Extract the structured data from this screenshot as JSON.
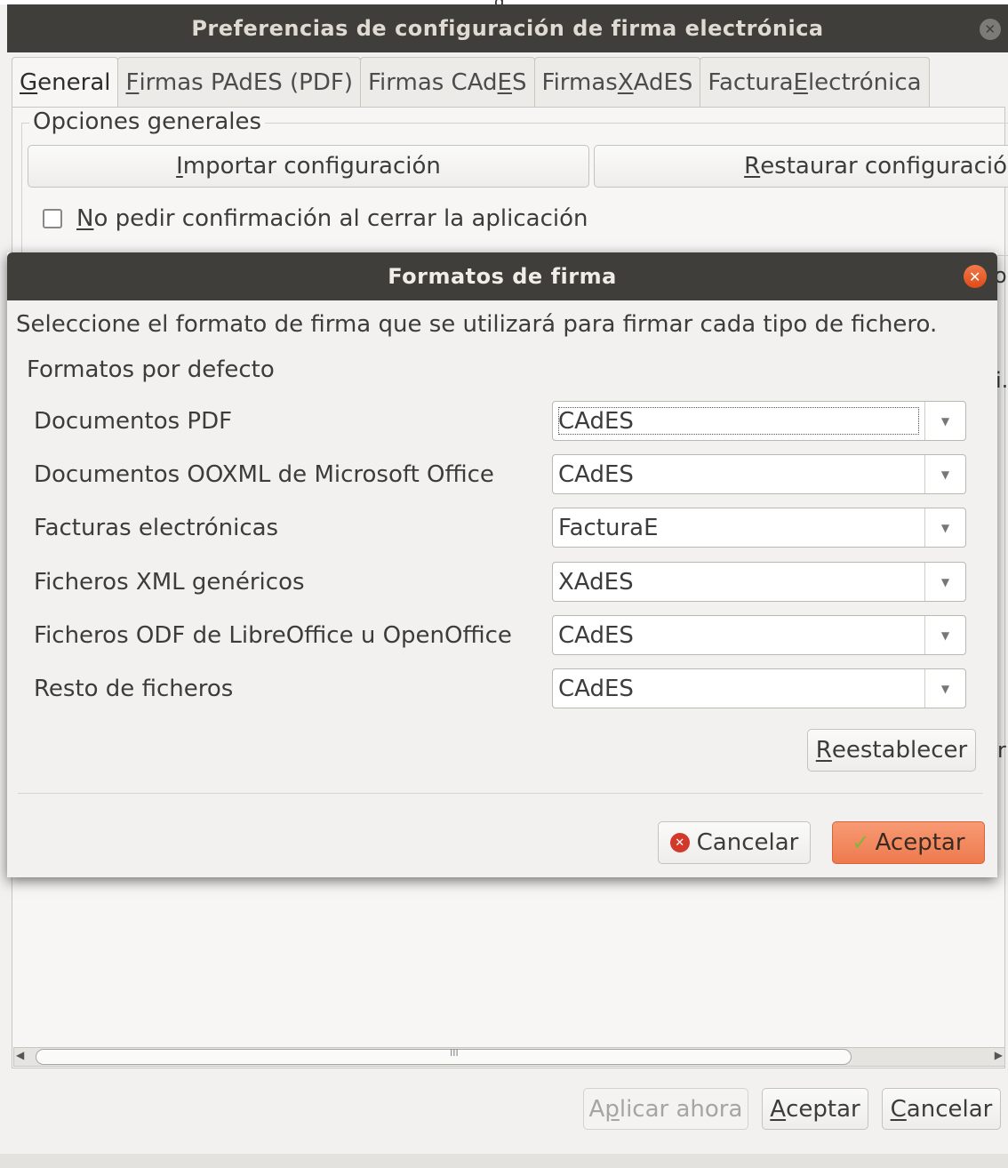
{
  "top_sliver_glyph": "g",
  "main_window": {
    "title": "Preferencias de configuración de firma electrónica",
    "tabs": [
      {
        "mnemonic": "G",
        "rest": "eneral"
      },
      {
        "mnemonic": "F",
        "rest": "irmas PAdES (PDF)"
      },
      {
        "pre": "Firmas CAd",
        "mnemonic": "E",
        "post": "S"
      },
      {
        "pre": "Firmas ",
        "mnemonic": "X",
        "post": "AdES"
      },
      {
        "pre": "Factura ",
        "mnemonic": "E",
        "post": "lectrónica"
      }
    ],
    "general_group_title": "Opciones generales",
    "import_button": {
      "mnemonic": "I",
      "rest": "mportar configuración"
    },
    "restore_button": {
      "mnemonic": "R",
      "rest": "estaurar configuració"
    },
    "confirm_checkbox": {
      "mnemonic": "N",
      "rest": "o pedir confirmación al cerrar la aplicación",
      "checked": false
    },
    "edge_fragments": [
      "o",
      "i.",
      "r"
    ],
    "scrollbar_grip": "III",
    "footer": {
      "apply_now": {
        "pre": "A",
        "mnemonic": "p",
        "post": "licar ahora",
        "enabled": false
      },
      "accept": {
        "mnemonic": "A",
        "rest": "ceptar"
      },
      "cancel": {
        "mnemonic": "C",
        "rest": "ancelar"
      }
    }
  },
  "dialog": {
    "title": "Formatos de firma",
    "description": "Seleccione el formato de firma que se utilizará para firmar cada tipo de fichero.",
    "section_title": "Formatos por defecto",
    "formats": [
      {
        "label": "Documentos PDF",
        "value": "CAdES"
      },
      {
        "label": "Documentos OOXML de Microsoft Office",
        "value": "CAdES"
      },
      {
        "label": "Facturas electrónicas",
        "value": "FacturaE"
      },
      {
        "label": "Ficheros XML genéricos",
        "value": "XAdES"
      },
      {
        "label": "Ficheros ODF de LibreOffice u OpenOffice",
        "value": "CAdES"
      },
      {
        "label": "Resto de ficheros",
        "value": "CAdES"
      }
    ],
    "reset_button": {
      "mnemonic": "R",
      "rest": "eestablecer"
    },
    "cancel_button": "Cancelar",
    "accept_button": "Aceptar"
  },
  "colors": {
    "titlebar": "#3f3e3b",
    "accent": "#ee7a4d",
    "window_bg": "#f2f1f0"
  }
}
